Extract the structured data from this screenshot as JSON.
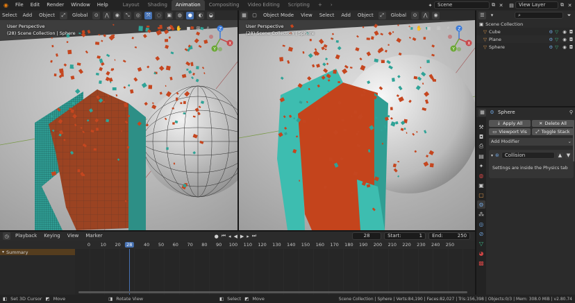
{
  "app": {
    "menus": [
      "File",
      "Edit",
      "Render",
      "Window",
      "Help"
    ],
    "workspaces": [
      "Layout",
      "Shading",
      "Animation",
      "Compositing",
      "Video Editing",
      "Scripting"
    ],
    "active_workspace": "Animation",
    "add_tab_label": "+",
    "scene": "Scene",
    "view_layer": "View Layer"
  },
  "viewport_left": {
    "menus": [
      "Select",
      "Add",
      "Object"
    ],
    "orientation": "Global",
    "perspective": "User Perspective",
    "collection": "(28) Scene Collection | Sphere"
  },
  "viewport_right": {
    "mode": "Object Mode",
    "menus": [
      "View",
      "Select",
      "Add",
      "Object"
    ],
    "orientation": "Global",
    "perspective": "User Perspective",
    "collection": "(28) Scene Collection | Sphere"
  },
  "outliner": {
    "root": "Scene Collection",
    "items": [
      {
        "name": "Cube",
        "icon": "cube-object-icon"
      },
      {
        "name": "Plane",
        "icon": "plane-object-icon"
      },
      {
        "name": "Sphere",
        "icon": "sphere-object-icon"
      }
    ]
  },
  "properties": {
    "object_name": "Sphere",
    "apply_all": "Apply All",
    "delete_all": "Delete All",
    "viewport_vis": "Viewport Vis",
    "toggle_stack": "Toggle Stack",
    "add_modifier": "Add Modifier",
    "modifier_name": "Collision",
    "modifier_note": "Settings are inside the Physics tab"
  },
  "timeline": {
    "menus": [
      "Playback",
      "Keying",
      "View",
      "Marker"
    ],
    "current_frame": "28",
    "start_label": "Start:",
    "start_value": "1",
    "end_label": "End:",
    "end_value": "250",
    "summary_label": "Summary",
    "ticks": [
      "0",
      "10",
      "20",
      "28",
      "40",
      "50",
      "60",
      "70",
      "80",
      "90",
      "100",
      "110",
      "120",
      "130",
      "140",
      "150",
      "160",
      "170",
      "180",
      "190",
      "200",
      "210",
      "220",
      "230",
      "240",
      "250"
    ]
  },
  "statusbar": {
    "left_items": [
      "Set 3D Cursor",
      "Move",
      "Rotate View",
      "Select",
      "Move"
    ],
    "stats": "Scene Collection | Sphere | Verts:84,190 | Faces:82,027 | Tris:156,398 | Objects:0/3 | Mem: 308.0 MiB | v2.80.74"
  },
  "colors": {
    "accent": "#4772b3",
    "debris": "#c5461f",
    "wall": "#3aaba0",
    "frame_marker": "#4772b3"
  }
}
